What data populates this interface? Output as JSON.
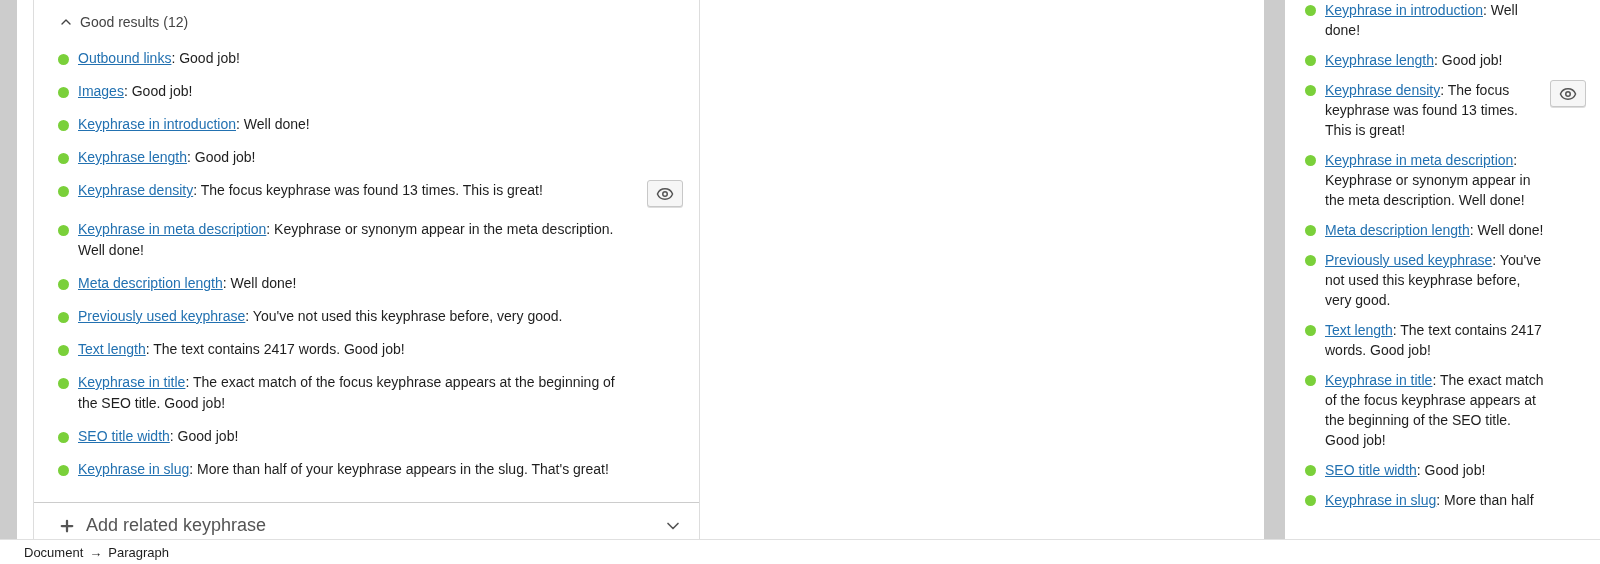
{
  "left_panel": {
    "section": {
      "title": "Good results (12)",
      "expanded": true,
      "results": [
        {
          "link": "Outbound links",
          "text": ": Good job!",
          "eye_button": false
        },
        {
          "link": "Images",
          "text": ": Good job!",
          "eye_button": false
        },
        {
          "link": "Keyphrase in introduction",
          "text": ": Well done!",
          "eye_button": false
        },
        {
          "link": "Keyphrase length",
          "text": ": Good job!",
          "eye_button": false
        },
        {
          "link": "Keyphrase density",
          "text": ": The focus keyphrase was found 13 times. This is great!",
          "eye_button": true
        },
        {
          "link": "Keyphrase in meta description",
          "text": ": Keyphrase or synonym appear in the meta description. Well done!",
          "eye_button": false
        },
        {
          "link": "Meta description length",
          "text": ": Well done!",
          "eye_button": false
        },
        {
          "link": "Previously used keyphrase",
          "text": ": You've not used this keyphrase before, very good.",
          "eye_button": false
        },
        {
          "link": "Text length",
          "text": ": The text contains 2417 words. Good job!",
          "eye_button": false
        },
        {
          "link": "Keyphrase in title",
          "text": ": The exact match of the focus keyphrase appears at the beginning of the SEO title. Good job!",
          "eye_button": false
        },
        {
          "link": "SEO title width",
          "text": ": Good job!",
          "eye_button": false
        },
        {
          "link": "Keyphrase in slug",
          "text": ": More than half of your keyphrase appears in the slug. That's great!",
          "eye_button": false
        }
      ]
    },
    "add_related": {
      "label": "Add related keyphrase",
      "expanded": false
    }
  },
  "right_panel": {
    "results": [
      {
        "link": "Keyphrase in introduction",
        "text": ": Well done!",
        "eye_button": false
      },
      {
        "link": "Keyphrase length",
        "text": ": Good job!",
        "eye_button": false
      },
      {
        "link": "Keyphrase density",
        "text": ": The focus keyphrase was found 13 times. This is great!",
        "eye_button": true
      },
      {
        "link": "Keyphrase in meta description",
        "text": ": Keyphrase or synonym appear in the meta description. Well done!",
        "eye_button": false
      },
      {
        "link": "Meta description length",
        "text": ": Well done!",
        "eye_button": false
      },
      {
        "link": "Previously used keyphrase",
        "text": ": You've not used this keyphrase before, very good.",
        "eye_button": false
      },
      {
        "link": "Text length",
        "text": ": The text contains 2417 words. Good job!",
        "eye_button": false
      },
      {
        "link": "Keyphrase in title",
        "text": ": The exact match of the focus keyphrase appears at the beginning of the SEO title. Good job!",
        "eye_button": false
      },
      {
        "link": "SEO title width",
        "text": ": Good job!",
        "eye_button": false
      },
      {
        "link": "Keyphrase in slug",
        "text": ": More than half",
        "eye_button": false
      }
    ]
  },
  "status_bar": {
    "breadcrumbs": [
      "Document",
      "Paragraph"
    ],
    "separator": "→"
  }
}
